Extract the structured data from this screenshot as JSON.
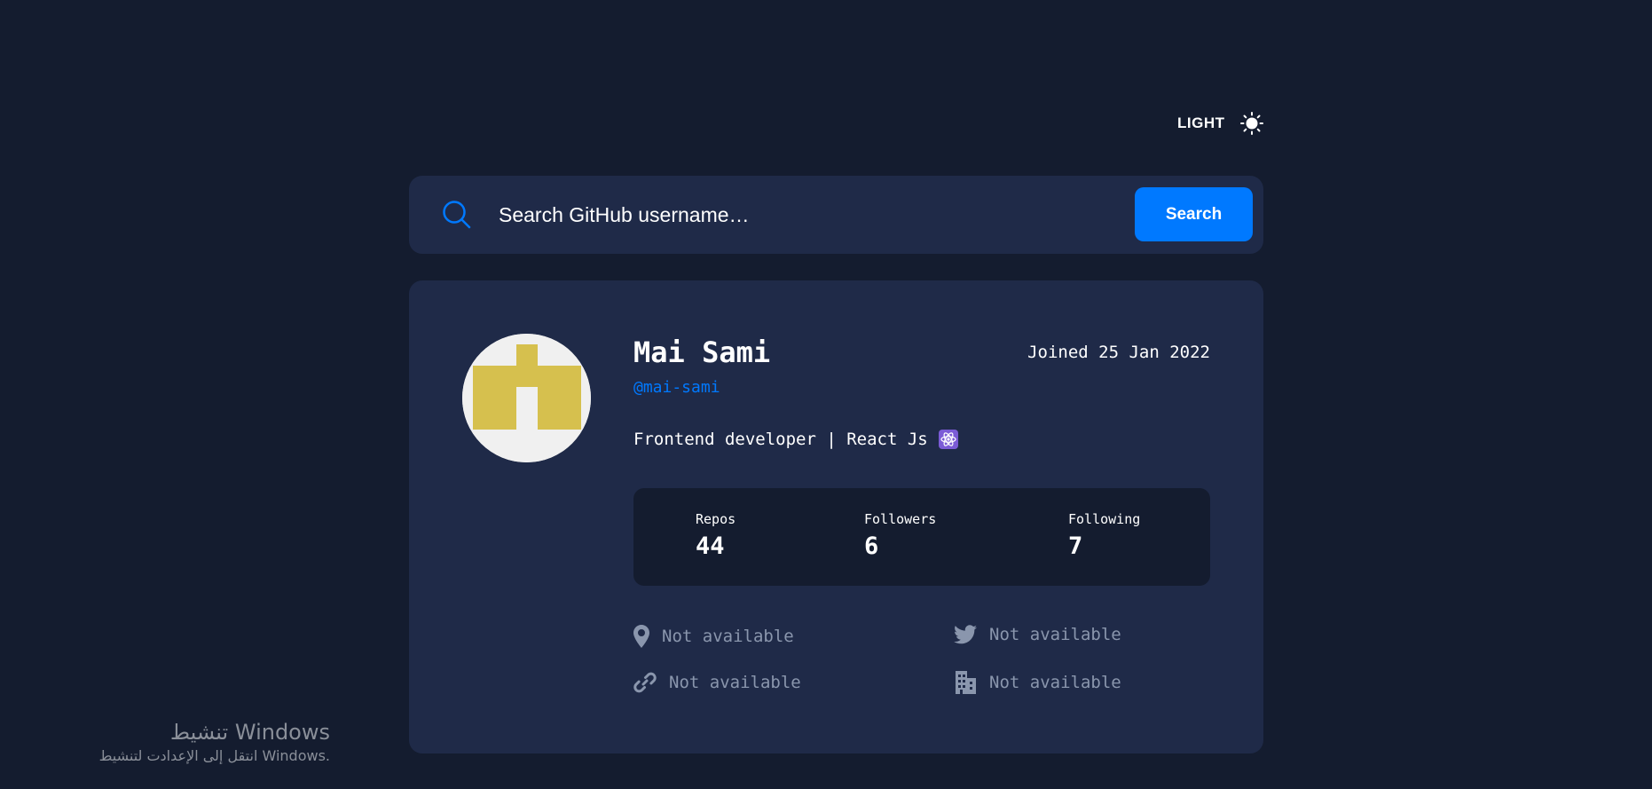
{
  "theme": {
    "toggle_label": "LIGHT",
    "icon": "sun-icon"
  },
  "search": {
    "placeholder": "Search GitHub username…",
    "button_label": "Search",
    "icon": "search-icon"
  },
  "profile": {
    "name": "Mai Sami",
    "login": "@mai-sami",
    "joined": "Joined 25 Jan 2022",
    "bio": "Frontend developer | React Js",
    "bio_icon": "atom-icon",
    "stats": [
      {
        "label": "Repos",
        "value": "44"
      },
      {
        "label": "Followers",
        "value": "6"
      },
      {
        "label": "Following",
        "value": "7"
      }
    ],
    "links": {
      "location": "Not available",
      "twitter": "Not available",
      "blog": "Not available",
      "company": "Not available"
    }
  },
  "watermark": {
    "title": "تنشيط Windows",
    "subtitle": "انتقل إلى الإعدادت لتنشيط Windows."
  },
  "colors": {
    "background": "#141c2f",
    "card": "#1f2a48",
    "accent": "#0079ff",
    "muted_text": "#8a96ad",
    "avatar_identicon": "#d6c04e"
  }
}
